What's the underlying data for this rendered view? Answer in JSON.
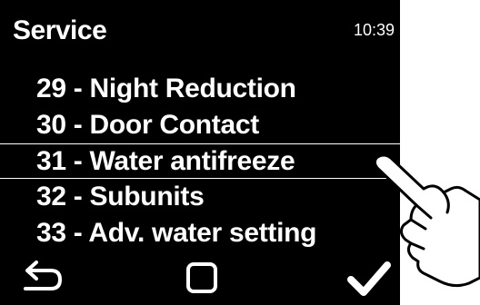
{
  "header": {
    "title": "Service",
    "time": "10:39"
  },
  "menu": {
    "items": [
      {
        "label": "29 - Night Reduction",
        "selected": false
      },
      {
        "label": "30 - Door Contact",
        "selected": false
      },
      {
        "label": "31 - Water antifreeze",
        "selected": true
      },
      {
        "label": "32 - Subunits",
        "selected": false
      },
      {
        "label": "33 - Adv. water setting",
        "selected": false
      }
    ]
  },
  "footer": {
    "icons": [
      "back-arrow-icon",
      "square-home-icon",
      "checkmark-icon"
    ]
  },
  "colors": {
    "screen_background": "#000000",
    "text": "#ffffff",
    "page_background": "#ffffff"
  }
}
